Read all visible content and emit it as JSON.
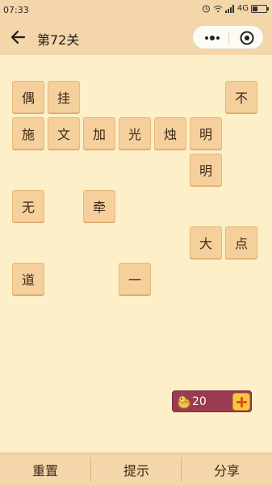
{
  "status_bar": {
    "time": "07:33",
    "network": "4G"
  },
  "nav": {
    "title": "第72关"
  },
  "tiles": [
    "偶",
    "挂",
    "不",
    "施",
    "文",
    "加",
    "光",
    "烛",
    "明",
    "明",
    "无",
    "牵",
    "大",
    "点",
    "道",
    "一"
  ],
  "hints": {
    "count": "20"
  },
  "bottom_bar": {
    "reset": "重置",
    "hint": "提示",
    "share": "分享"
  },
  "colors": {
    "background": "#fdefc7",
    "bar": "#f3d6a9",
    "tile": "#f5cf9c",
    "coin_bar": "#9b3b52",
    "plus_button": "#f7c93a"
  }
}
